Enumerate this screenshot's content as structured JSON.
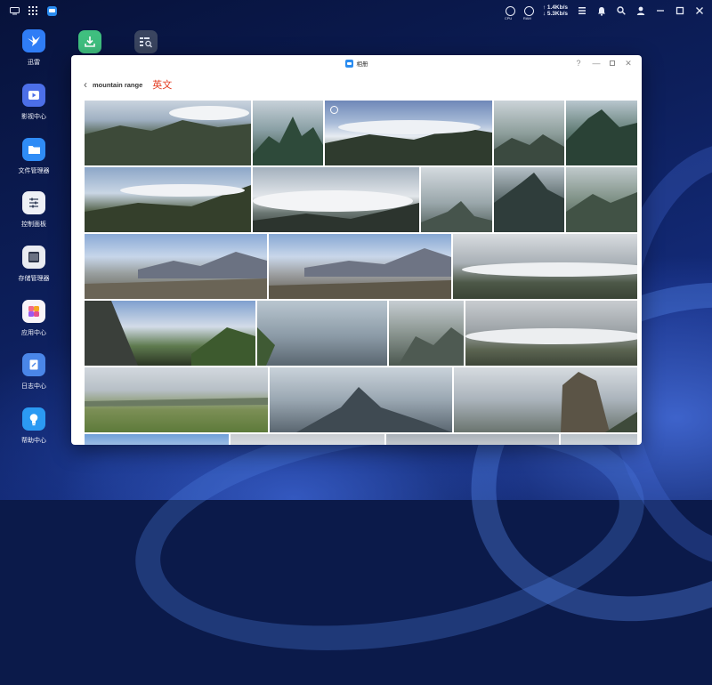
{
  "desktop": {
    "icons": [
      {
        "label": "迅雷",
        "icon": "bird-icon",
        "color": "#2f7df6"
      },
      {
        "label": "影视中心",
        "icon": "play-icon",
        "color": "#4c6fe8"
      },
      {
        "label": "文件管理器",
        "icon": "folder-icon",
        "color": "#2f8cf6"
      },
      {
        "label": "控制面板",
        "icon": "sliders-icon",
        "color": "#eef0f6"
      },
      {
        "label": "存储管理器",
        "icon": "disk-icon",
        "color": "#e9ebf1"
      },
      {
        "label": "应用中心",
        "icon": "apps-icon",
        "color": "#f8f4f8"
      },
      {
        "label": "日志中心",
        "icon": "log-icon",
        "color": "#4a86e8"
      },
      {
        "label": "帮助中心",
        "icon": "bulb-icon",
        "color": "#2b9af3"
      }
    ],
    "top_icons": [
      {
        "icon": "download-icon",
        "color": "#3fbf7f"
      },
      {
        "icon": "image-search-icon",
        "color": "#3a4560"
      }
    ]
  },
  "system_bar": {
    "upload_speed": "↑ 1.4Kb/s",
    "download_speed": "↓ 5.3Kb/s",
    "cpu_label": "CPU",
    "ram_label": "RAM"
  },
  "window": {
    "title": "相册",
    "help": "?",
    "minimize": "—",
    "close": "✕",
    "search_query": "mountain range",
    "search_tag": "英文"
  },
  "photos": [
    {
      "alt": "mountain-valley-clouds"
    },
    {
      "alt": "green-peaks"
    },
    {
      "alt": "cloud-sea-ridge"
    },
    {
      "alt": "misty-peaks"
    },
    {
      "alt": "green-cliff"
    },
    {
      "alt": "cloudy-ridge-trees"
    },
    {
      "alt": "cloud-sea"
    },
    {
      "alt": "foggy-pinnacles"
    },
    {
      "alt": "dark-peak"
    },
    {
      "alt": "river-valley"
    },
    {
      "alt": "snowy-range-road"
    },
    {
      "alt": "snowy-range-rocks"
    },
    {
      "alt": "grassland-clouds"
    },
    {
      "alt": "car-window-view"
    },
    {
      "alt": "hazy-plain"
    },
    {
      "alt": "canyon-road"
    },
    {
      "alt": "overcast-grassland"
    },
    {
      "alt": "green-meadow"
    },
    {
      "alt": "summit-haze"
    },
    {
      "alt": "cliff-tower"
    },
    {
      "alt": "bottom-row-1"
    },
    {
      "alt": "bottom-row-2"
    },
    {
      "alt": "bottom-row-3"
    },
    {
      "alt": "bottom-row-4"
    }
  ]
}
